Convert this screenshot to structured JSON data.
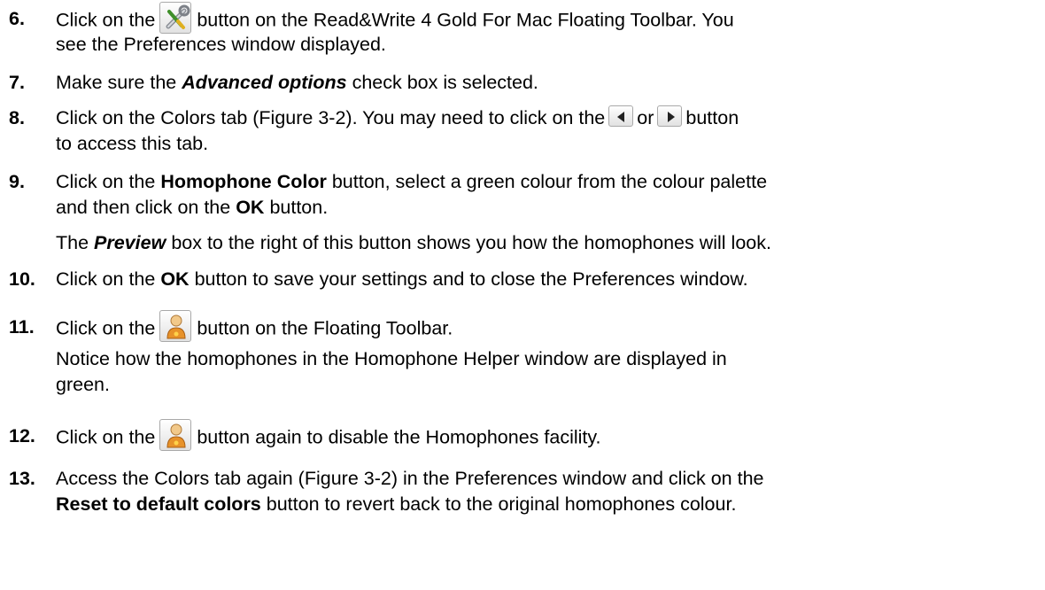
{
  "steps": [
    {
      "num": "6.",
      "a": "Click on the",
      "b": "button on the Read&Write 4 Gold For Mac Floating Toolbar. You",
      "c": "see the Preferences window displayed."
    },
    {
      "num": "7.",
      "a": "Make sure the",
      "b": "Advanced options",
      "c": "check box is selected."
    },
    {
      "num": "8.",
      "a": "Click on the Colors tab (Figure 3-2). You may need to click on the",
      "b": "or",
      "c": "button",
      "d": "to access this tab."
    },
    {
      "num": "9.",
      "a": "Click on the",
      "b": "Homophone Color",
      "c": "button, select a green colour from the colour palette",
      "d": "and then click on the",
      "e": "OK",
      "f": "button.",
      "g": "The",
      "h": "Preview",
      "i": "box to the right of this button shows you how the homophones will look."
    },
    {
      "num": "10.",
      "a": "Click on the",
      "b": "OK",
      "c": "button to save your settings and to close the Preferences window."
    },
    {
      "num": "11.",
      "a": "Click on the",
      "b": "button on the Floating Toolbar.",
      "c": "Notice how the homophones in the Homophone Helper window are displayed in",
      "d": "green."
    },
    {
      "num": "12.",
      "a": "Click on the",
      "b": "button again to disable the Homophones facility."
    },
    {
      "num": "13.",
      "a": "Access the Colors tab again (Figure 3-2) in the Preferences window and click on the",
      "b": "Reset to default colors",
      "c": "button to revert back to the original homophones colour."
    }
  ],
  "icons": {
    "preferences": "tools-icon",
    "scroll_left": "left-arrow-icon",
    "scroll_right": "right-arrow-icon",
    "homophones": "homophones-person-icon"
  }
}
